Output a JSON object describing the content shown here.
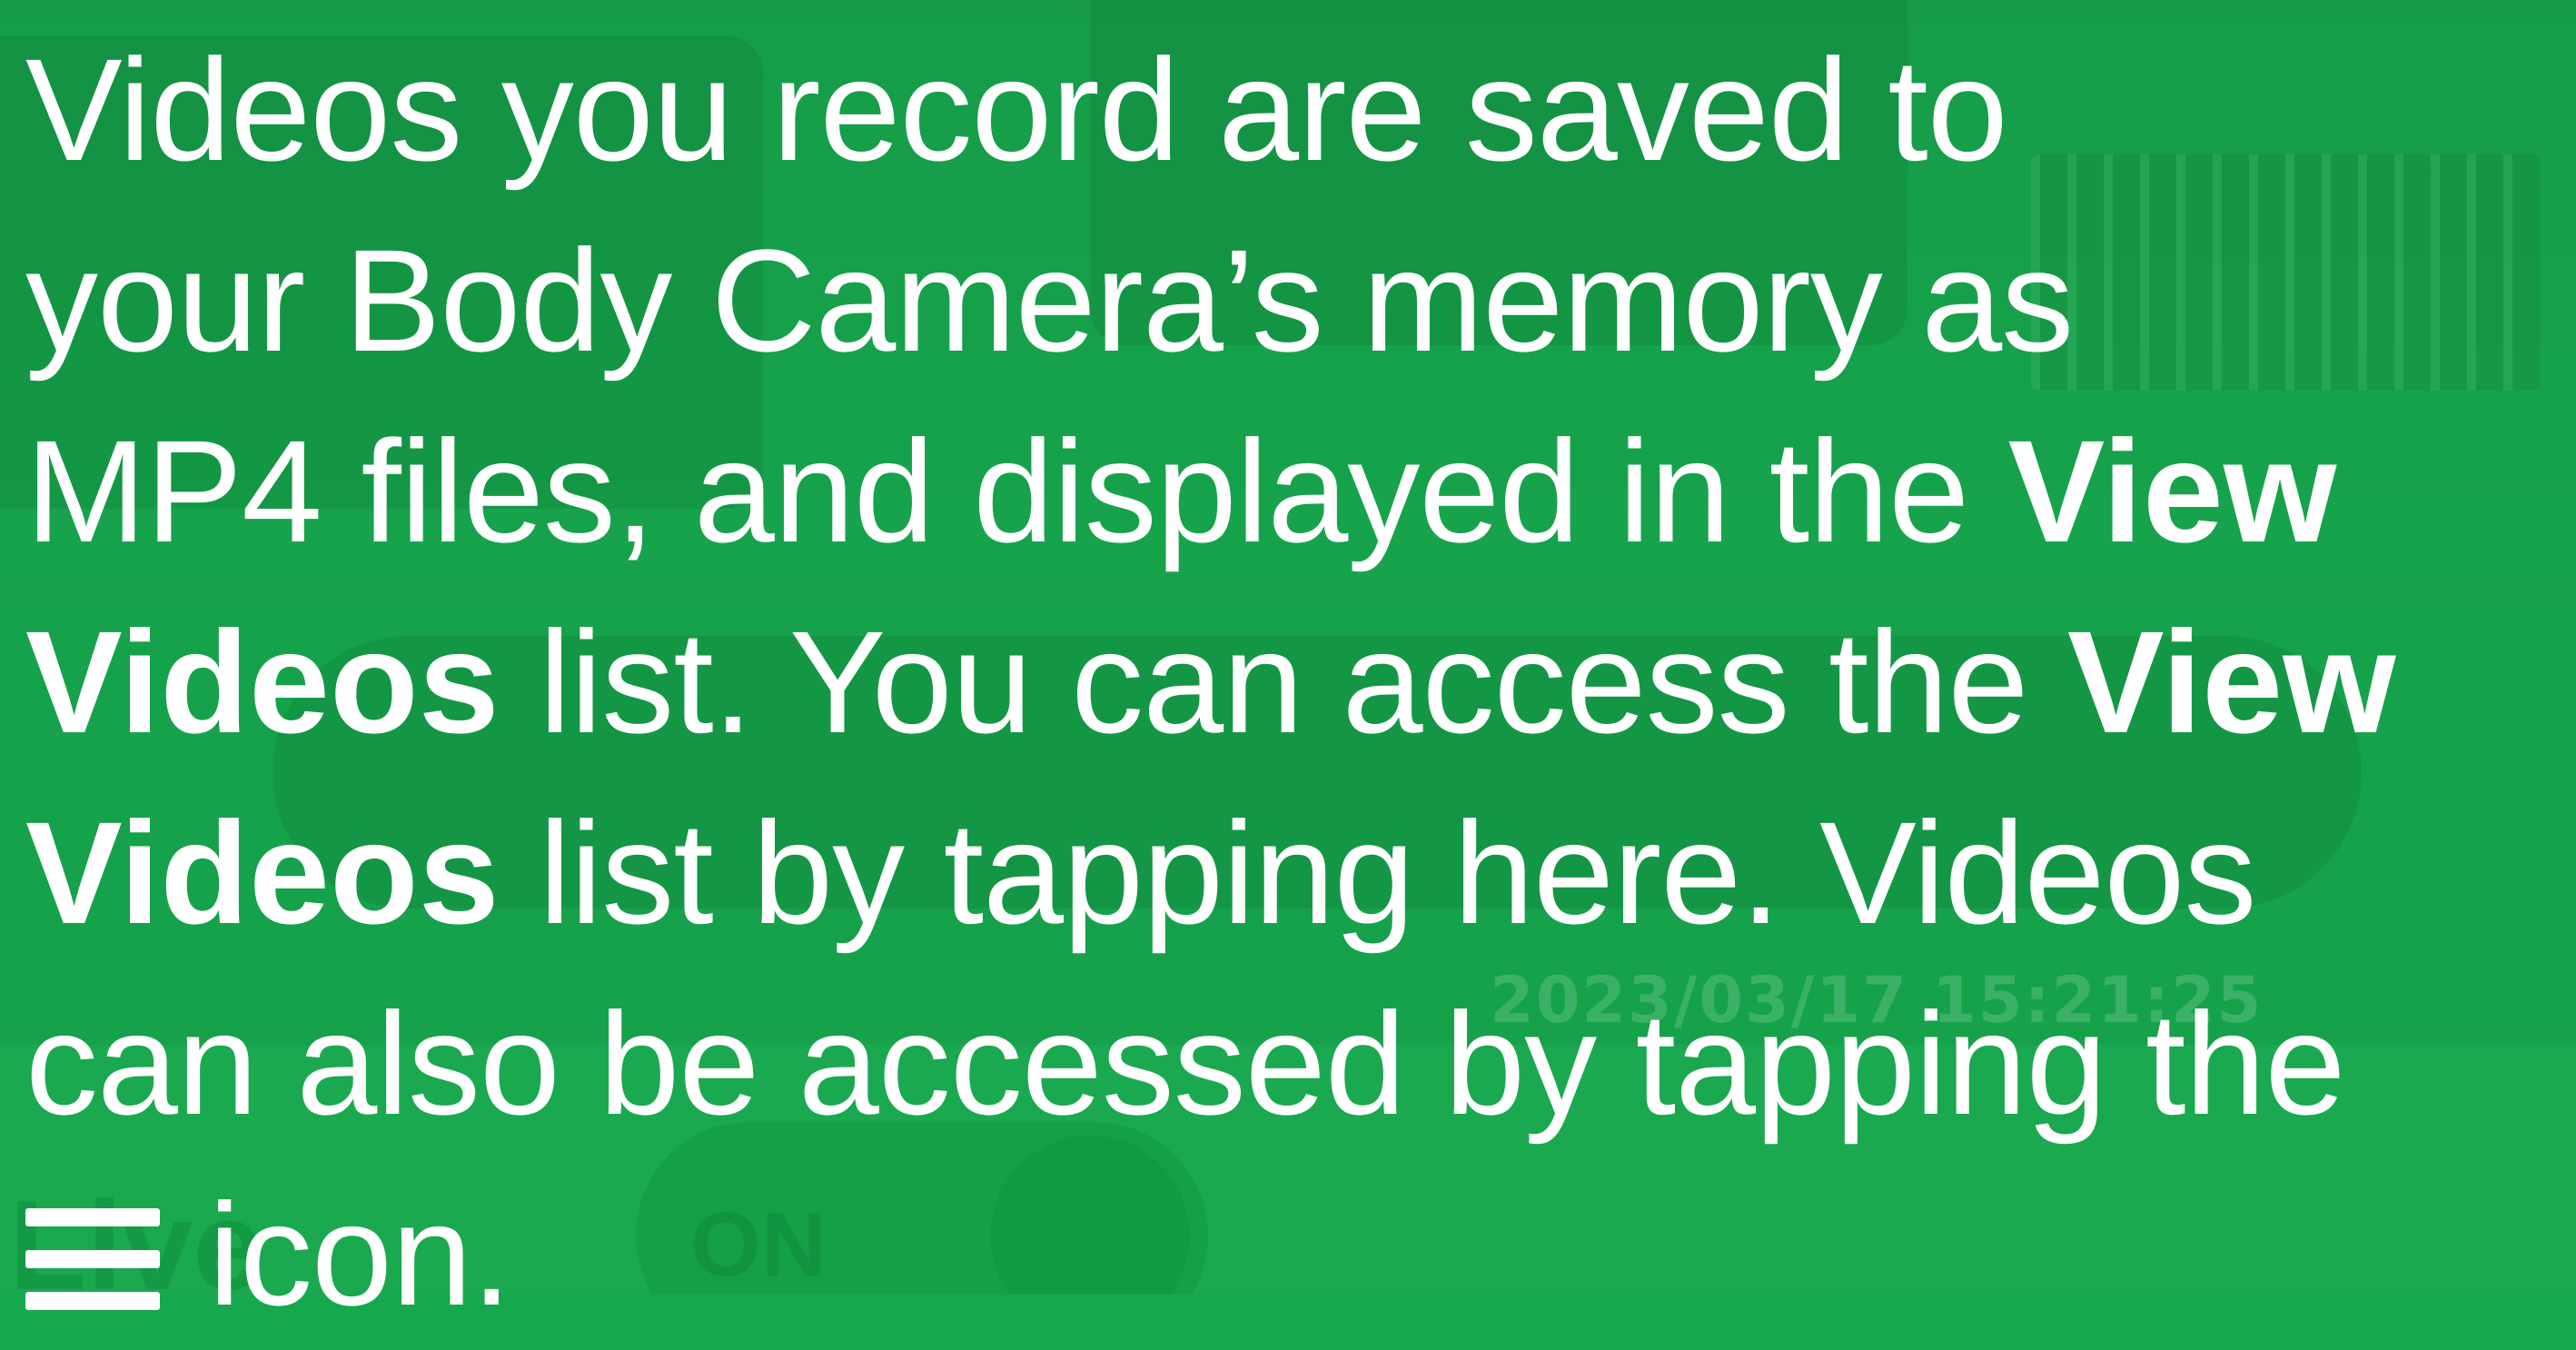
{
  "camera_view": {
    "timestamp": "2023/03/17 15:21:25",
    "live_label": "Live",
    "toggle_label": "ON"
  },
  "tutorial": {
    "line1": "Videos you record are saved to",
    "line2": "your Body Camera’s memory as",
    "line3_pre": "MP4 files, and displayed in the ",
    "bold_view_1": "View",
    "bold_videos_1": "Videos",
    "line4_mid": " list. You can access the ",
    "bold_view_2": "View",
    "bold_videos_2": "Videos",
    "line5_post": " list by tapping here. Videos",
    "line6": "can also be accessed by tapping the",
    "line7_post": " icon.",
    "menu_icon": "hamburger-menu-icon"
  },
  "colors": {
    "overlay": "#16a84c",
    "text": "#ffffff"
  }
}
